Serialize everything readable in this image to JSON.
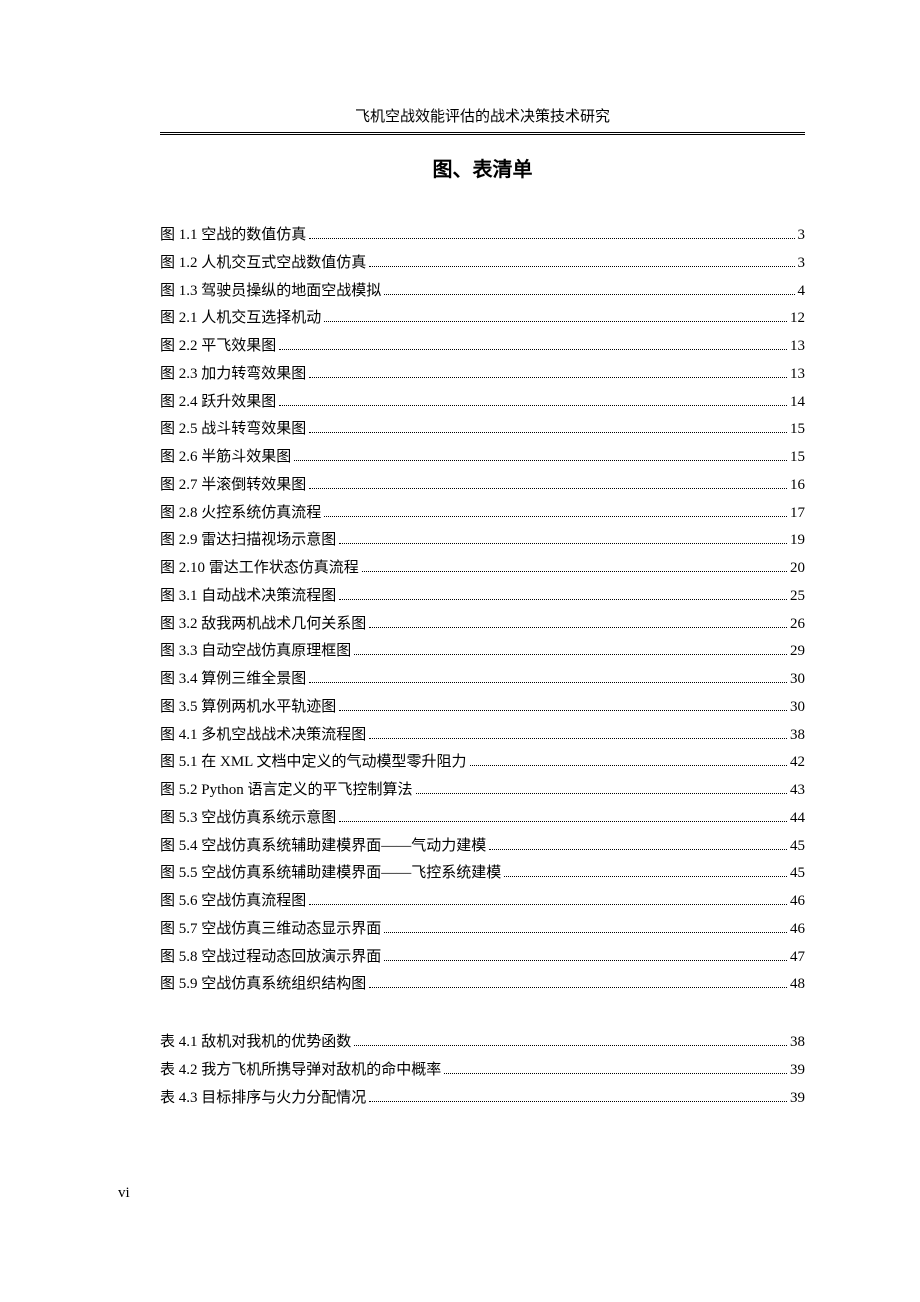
{
  "running_head": "飞机空战效能评估的战术决策技术研究",
  "title": "图、表清单",
  "figures": [
    {
      "label": "图 1.1  空战的数值仿真",
      "page": "3"
    },
    {
      "label": "图 1.2  人机交互式空战数值仿真",
      "page": "3"
    },
    {
      "label": "图 1.3  驾驶员操纵的地面空战模拟",
      "page": "4"
    },
    {
      "label": "图 2.1  人机交互选择机动",
      "page": "12"
    },
    {
      "label": "图 2.2  平飞效果图",
      "page": "13"
    },
    {
      "label": "图 2.3  加力转弯效果图",
      "page": "13"
    },
    {
      "label": "图 2.4  跃升效果图",
      "page": "14"
    },
    {
      "label": "图 2.5  战斗转弯效果图",
      "page": "15"
    },
    {
      "label": "图 2.6  半筋斗效果图",
      "page": "15"
    },
    {
      "label": "图 2.7  半滚倒转效果图",
      "page": "16"
    },
    {
      "label": "图 2.8  火控系统仿真流程",
      "page": "17"
    },
    {
      "label": "图 2.9  雷达扫描视场示意图",
      "page": "19"
    },
    {
      "label": "图 2.10  雷达工作状态仿真流程",
      "page": "20"
    },
    {
      "label": "图 3.1  自动战术决策流程图",
      "page": "25"
    },
    {
      "label": "图 3.2  敌我两机战术几何关系图",
      "page": "26"
    },
    {
      "label": "图 3.3  自动空战仿真原理框图",
      "page": "29"
    },
    {
      "label": "图 3.4  算例三维全景图",
      "page": "30"
    },
    {
      "label": "图 3.5  算例两机水平轨迹图",
      "page": "30"
    },
    {
      "label": "图 4.1  多机空战战术决策流程图",
      "page": "38"
    },
    {
      "label": "图 5.1  在 XML 文档中定义的气动模型零升阻力",
      "page": "42"
    },
    {
      "label": "图 5.2 Python 语言定义的平飞控制算法",
      "page": "43"
    },
    {
      "label": "图 5.3  空战仿真系统示意图",
      "page": "44"
    },
    {
      "label": "图 5.4  空战仿真系统辅助建模界面——气动力建模",
      "page": "45"
    },
    {
      "label": "图 5.5  空战仿真系统辅助建模界面——飞控系统建模",
      "page": "45"
    },
    {
      "label": "图 5.6  空战仿真流程图",
      "page": "46"
    },
    {
      "label": "图 5.7  空战仿真三维动态显示界面",
      "page": "46"
    },
    {
      "label": "图 5.8  空战过程动态回放演示界面",
      "page": "47"
    },
    {
      "label": "图 5.9  空战仿真系统组织结构图",
      "page": "48"
    }
  ],
  "tables": [
    {
      "label": "表 4.1  敌机对我机的优势函数",
      "page": "38"
    },
    {
      "label": "表 4.2  我方飞机所携导弹对敌机的命中概率",
      "page": "39"
    },
    {
      "label": "表 4.3  目标排序与火力分配情况",
      "page": "39"
    }
  ],
  "folio": "vi"
}
